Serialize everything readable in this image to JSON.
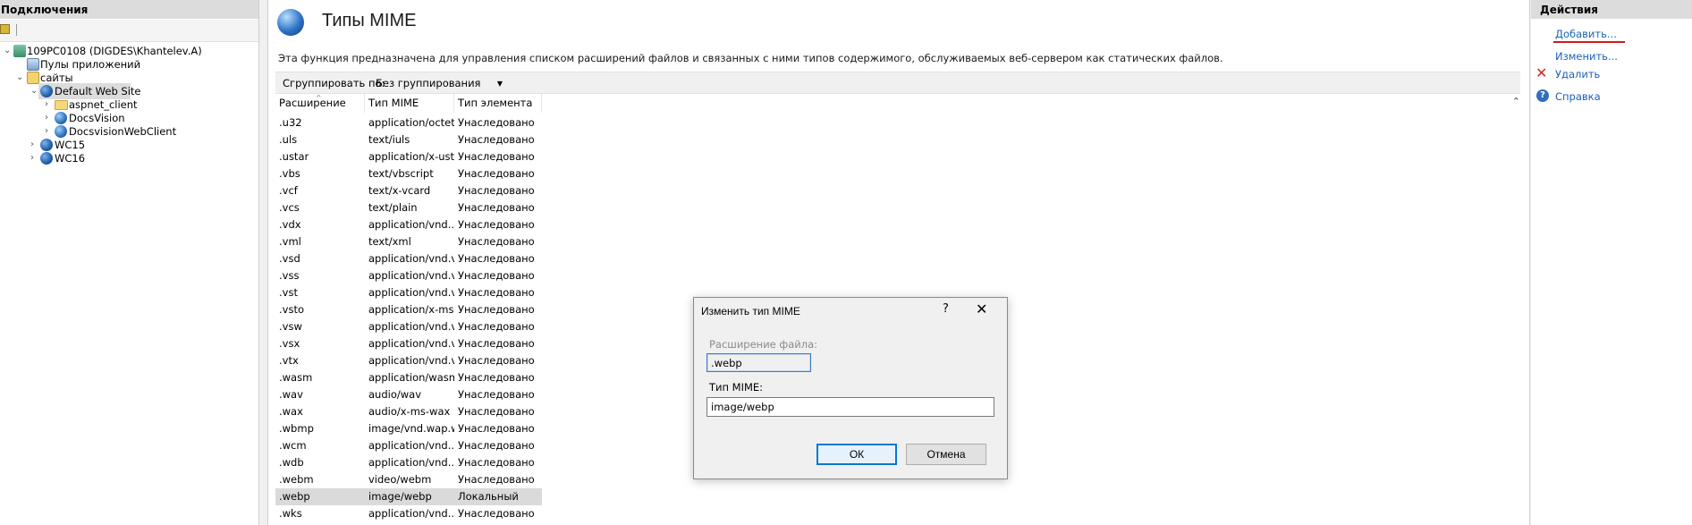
{
  "left_panel": {
    "header": "Подключения",
    "tree": [
      {
        "label": "109PC0108 (DIGDES\\Khantelev.A)",
        "icon": "server-icon"
      },
      {
        "label": "Пулы приложений",
        "icon": "app-pool-icon"
      },
      {
        "label": "сайты",
        "icon": "sites-icon"
      },
      {
        "label": "Default Web Site",
        "icon": "globe-icon"
      },
      {
        "label": "aspnet_client",
        "icon": "folder-icon"
      },
      {
        "label": "DocsVision",
        "icon": "application-icon"
      },
      {
        "label": "DocsvisionWebClient",
        "icon": "application-icon"
      },
      {
        "label": "WC15",
        "icon": "globe-icon"
      },
      {
        "label": "WC16",
        "icon": "globe-icon"
      }
    ]
  },
  "main": {
    "title": "Типы MIME",
    "description": "Эта функция предназначена для управления списком расширений файлов и связанных с ними типов содержимого, обслуживаемых веб-сервером как статических файлов.",
    "group_by_label": "Сгруппировать по:",
    "group_by_value": "Без группирования",
    "columns": [
      "Расширение",
      "Тип MIME",
      "Тип элемента"
    ],
    "rows": [
      [
        ".u32",
        "application/octet-...",
        "Унаследовано"
      ],
      [
        ".uls",
        "text/iuls",
        "Унаследовано"
      ],
      [
        ".ustar",
        "application/x-ustar",
        "Унаследовано"
      ],
      [
        ".vbs",
        "text/vbscript",
        "Унаследовано"
      ],
      [
        ".vcf",
        "text/x-vcard",
        "Унаследовано"
      ],
      [
        ".vcs",
        "text/plain",
        "Унаследовано"
      ],
      [
        ".vdx",
        "application/vnd....",
        "Унаследовано"
      ],
      [
        ".vml",
        "text/xml",
        "Унаследовано"
      ],
      [
        ".vsd",
        "application/vnd.vi...",
        "Унаследовано"
      ],
      [
        ".vss",
        "application/vnd.vi...",
        "Унаследовано"
      ],
      [
        ".vst",
        "application/vnd.vi...",
        "Унаследовано"
      ],
      [
        ".vsto",
        "application/x-ms-...",
        "Унаследовано"
      ],
      [
        ".vsw",
        "application/vnd.vi...",
        "Унаследовано"
      ],
      [
        ".vsx",
        "application/vnd.vi...",
        "Унаследовано"
      ],
      [
        ".vtx",
        "application/vnd.vi...",
        "Унаследовано"
      ],
      [
        ".wasm",
        "application/wasm",
        "Унаследовано"
      ],
      [
        ".wav",
        "audio/wav",
        "Унаследовано"
      ],
      [
        ".wax",
        "audio/x-ms-wax",
        "Унаследовано"
      ],
      [
        ".wbmp",
        "image/vnd.wap.w...",
        "Унаследовано"
      ],
      [
        ".wcm",
        "application/vnd....",
        "Унаследовано"
      ],
      [
        ".wdb",
        "application/vnd....",
        "Унаследовано"
      ],
      [
        ".webm",
        "video/webm",
        "Унаследовано"
      ],
      [
        ".webp",
        "image/webp",
        "Локальный"
      ],
      [
        ".wks",
        "application/vnd....",
        "Унаследовано"
      ]
    ],
    "selected_row": 22
  },
  "actions_panel": {
    "header": "Действия",
    "items": [
      "Добавить...",
      "Изменить...",
      "Удалить",
      "Справка"
    ]
  },
  "dialog": {
    "title": "Изменить тип MIME",
    "help_glyph": "?",
    "close_glyph": "✕",
    "ext_label": "Расширение файла:",
    "ext_value": ".webp",
    "mime_label": "Тип MIME:",
    "mime_value": "image/webp",
    "ok_label": "ОК",
    "cancel_label": "Отмена"
  }
}
